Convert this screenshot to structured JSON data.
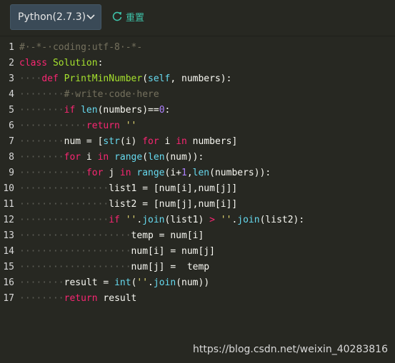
{
  "toolbar": {
    "language": "Python(2.7.3)",
    "reset_label": "重置"
  },
  "editor": {
    "lines": [
      [
        {
          "t": "cm",
          "v": "#·-*-·coding:utf-8·-*-"
        }
      ],
      [
        {
          "t": "kw",
          "v": "class"
        },
        {
          "t": "p",
          "v": " "
        },
        {
          "t": "fn",
          "v": "Solution"
        },
        {
          "t": "p",
          "v": ":"
        }
      ],
      [
        {
          "t": "ind",
          "v": "····"
        },
        {
          "t": "kw",
          "v": "def"
        },
        {
          "t": "p",
          "v": " "
        },
        {
          "t": "fn",
          "v": "PrintMinNumber"
        },
        {
          "t": "p",
          "v": "("
        },
        {
          "t": "bi",
          "v": "self"
        },
        {
          "t": "p",
          "v": ", numbers):"
        }
      ],
      [
        {
          "t": "ind",
          "v": "········"
        },
        {
          "t": "cm",
          "v": "#·write·code·here"
        }
      ],
      [
        {
          "t": "ind",
          "v": "········"
        },
        {
          "t": "kw",
          "v": "if"
        },
        {
          "t": "p",
          "v": " "
        },
        {
          "t": "bi",
          "v": "len"
        },
        {
          "t": "p",
          "v": "(numbers)=="
        },
        {
          "t": "num",
          "v": "0"
        },
        {
          "t": "p",
          "v": ":"
        }
      ],
      [
        {
          "t": "ind",
          "v": "············"
        },
        {
          "t": "kw",
          "v": "return"
        },
        {
          "t": "p",
          "v": " "
        },
        {
          "t": "str",
          "v": "''"
        }
      ],
      [
        {
          "t": "ind",
          "v": "········"
        },
        {
          "t": "p",
          "v": "num = ["
        },
        {
          "t": "bi",
          "v": "str"
        },
        {
          "t": "p",
          "v": "(i) "
        },
        {
          "t": "kw",
          "v": "for"
        },
        {
          "t": "p",
          "v": " i "
        },
        {
          "t": "kw",
          "v": "in"
        },
        {
          "t": "p",
          "v": " numbers]"
        }
      ],
      [
        {
          "t": "ind",
          "v": "········"
        },
        {
          "t": "kw",
          "v": "for"
        },
        {
          "t": "p",
          "v": " i "
        },
        {
          "t": "kw",
          "v": "in"
        },
        {
          "t": "p",
          "v": " "
        },
        {
          "t": "bi",
          "v": "range"
        },
        {
          "t": "p",
          "v": "("
        },
        {
          "t": "bi",
          "v": "len"
        },
        {
          "t": "p",
          "v": "(num)):"
        }
      ],
      [
        {
          "t": "ind",
          "v": "············"
        },
        {
          "t": "kw",
          "v": "for"
        },
        {
          "t": "p",
          "v": " j "
        },
        {
          "t": "kw",
          "v": "in"
        },
        {
          "t": "p",
          "v": " "
        },
        {
          "t": "bi",
          "v": "range"
        },
        {
          "t": "p",
          "v": "(i+"
        },
        {
          "t": "num",
          "v": "1"
        },
        {
          "t": "p",
          "v": ","
        },
        {
          "t": "bi",
          "v": "len"
        },
        {
          "t": "p",
          "v": "(numbers)):"
        }
      ],
      [
        {
          "t": "ind",
          "v": "················"
        },
        {
          "t": "p",
          "v": "list1 = [num[i],num[j]]"
        }
      ],
      [
        {
          "t": "ind",
          "v": "················"
        },
        {
          "t": "p",
          "v": "list2 = [num[j],num[i]]"
        }
      ],
      [
        {
          "t": "ind",
          "v": "················"
        },
        {
          "t": "kw",
          "v": "if"
        },
        {
          "t": "p",
          "v": " "
        },
        {
          "t": "str",
          "v": "''"
        },
        {
          "t": "p",
          "v": "."
        },
        {
          "t": "bi",
          "v": "join"
        },
        {
          "t": "p",
          "v": "(list1) "
        },
        {
          "t": "kw",
          "v": ">"
        },
        {
          "t": "p",
          "v": " "
        },
        {
          "t": "str",
          "v": "''"
        },
        {
          "t": "p",
          "v": "."
        },
        {
          "t": "bi",
          "v": "join"
        },
        {
          "t": "p",
          "v": "(list2):"
        }
      ],
      [
        {
          "t": "ind",
          "v": "····················"
        },
        {
          "t": "p",
          "v": "temp = num[i]"
        }
      ],
      [
        {
          "t": "ind",
          "v": "····················"
        },
        {
          "t": "p",
          "v": "num[i] = num[j]"
        }
      ],
      [
        {
          "t": "ind",
          "v": "····················"
        },
        {
          "t": "p",
          "v": "num[j] =  temp"
        }
      ],
      [
        {
          "t": "ind",
          "v": "········"
        },
        {
          "t": "p",
          "v": "result = "
        },
        {
          "t": "bi",
          "v": "int"
        },
        {
          "t": "p",
          "v": "("
        },
        {
          "t": "str",
          "v": "''"
        },
        {
          "t": "p",
          "v": "."
        },
        {
          "t": "bi",
          "v": "join"
        },
        {
          "t": "p",
          "v": "(num))"
        }
      ],
      [
        {
          "t": "ind",
          "v": "········"
        },
        {
          "t": "kw",
          "v": "return"
        },
        {
          "t": "p",
          "v": " result"
        }
      ]
    ]
  },
  "watermark": "https://blog.csdn.net/weixin_40283816",
  "colors": {
    "background": "#272822",
    "accent": "#3ec1a8",
    "keyword": "#f92672",
    "function": "#a6e22e",
    "builtin": "#66d9ef",
    "number": "#ae81ff",
    "string": "#e6db74",
    "comment": "#75715e"
  },
  "icons": {
    "language_dropdown": "chevron-down-icon",
    "reset": "refresh-icon"
  }
}
